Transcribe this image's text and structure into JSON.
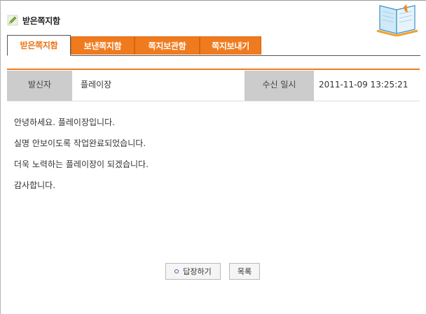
{
  "header": {
    "title": "받은쪽지함"
  },
  "tabs": [
    {
      "label": "받은쪽지함"
    },
    {
      "label": "보낸쪽지함"
    },
    {
      "label": "쪽지보관함"
    },
    {
      "label": "쪽지보내기"
    }
  ],
  "info": {
    "sender_label": "발신자",
    "sender_value": "플레이장",
    "received_label": "수신 일시",
    "received_value": "2011-11-09 13:25:21"
  },
  "message": {
    "lines": [
      "안녕하세요. 플레이장입니다.",
      "실명 안보이도록 작업완료되었습니다.",
      "더욱 노력하는 플레이장이 되겠습니다.",
      "감사합니다."
    ]
  },
  "buttons": {
    "reply_label": "답장하기",
    "list_label": "목록"
  },
  "icons": {
    "title_icon": "pencil-icon",
    "decor_icon": "book-icon",
    "reply_icon": "dot-icon"
  },
  "colors": {
    "accent": "#f07b1e",
    "label_bg": "#cccccc"
  }
}
